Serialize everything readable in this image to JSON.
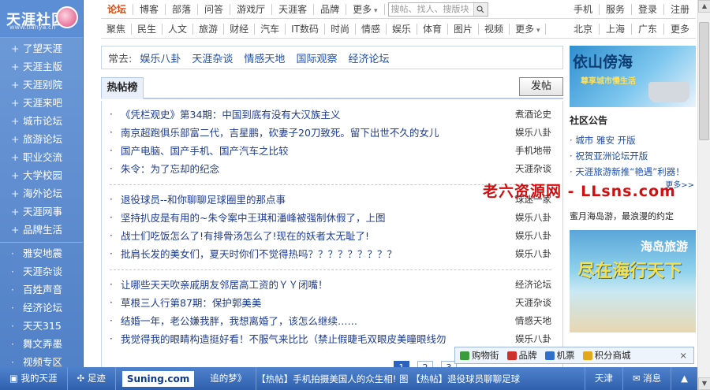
{
  "logo": {
    "name": "天涯社区",
    "url": "www.tianya.cn"
  },
  "sidebar": {
    "primary": [
      "了望天涯",
      "天涯主版",
      "天涯别院",
      "天涯来吧",
      "城市论坛",
      "旅游论坛",
      "职业交流",
      "大学校园",
      "海外论坛",
      "天涯网事",
      "品牌生活"
    ],
    "secondary": [
      "雅安地震",
      "天涯杂谈",
      "百姓声音",
      "经济论坛",
      "天天315",
      "舞文弄墨",
      "视频专区"
    ]
  },
  "topbar": {
    "tabs": [
      "论坛",
      "博客",
      "部落",
      "问答",
      "游戏厅",
      "天涯客",
      "品牌",
      "更多"
    ],
    "search_placeholder": "搜帖、找人、搜版块",
    "right": [
      "手机",
      "服务",
      "登录",
      "注册"
    ]
  },
  "subbar": {
    "tabs": [
      "聚焦",
      "民生",
      "人文",
      "旅游",
      "财经",
      "汽车",
      "IT数码",
      "时尚",
      "情感",
      "娱乐",
      "体育",
      "图片",
      "视频",
      "更多"
    ],
    "right": [
      "北京",
      "上海",
      "广东",
      "更多"
    ]
  },
  "frequent": {
    "label": "常去:",
    "links": [
      "娱乐八卦",
      "天涯杂谈",
      "情感天地",
      "国际观察",
      "经济论坛"
    ]
  },
  "hot": {
    "tab": "热帖榜",
    "post_button": "发帖",
    "groups": [
      [
        {
          "title": "《凭栏观史》第34期：中国到底有没有大汉族主义",
          "cat": "煮酒论史"
        },
        {
          "title": "南京超跑俱乐部富二代，吉星鹏，砍妻子20刀致死。留下出世不久的女儿",
          "cat": "娱乐八卦"
        },
        {
          "title": "国产电脑、国产手机、国产汽车之比较",
          "cat": "手机地带"
        },
        {
          "title": "朱令：为了忘却的纪念",
          "cat": "天涯杂谈"
        }
      ],
      [
        {
          "title": "退役球员--和你聊聊足球圈里的那点事",
          "cat": "球迷一家"
        },
        {
          "title": "坚持扒皮是有用的~朱令案中王琪和潘峰被强制休假了，上图",
          "cat": "娱乐八卦"
        },
        {
          "title": "战士们吃饭怎么了!有排骨汤怎么了!现在的妖者太无耻了!",
          "cat": "娱乐八卦"
        },
        {
          "title": "批肩长发的美女们，夏天时你们不觉得热吗？？？？？？？？？",
          "cat": "娱乐八卦"
        }
      ],
      [
        {
          "title": "让哪些天天吹亲戚朋友邻居高工资的ＹＹ闭嘴！",
          "cat": "经济论坛"
        },
        {
          "title": "草根三人行第87期：保护郭美美",
          "cat": "天涯杂谈"
        },
        {
          "title": "结婚一年，老公嫌我胖，我想离婚了，该怎么继续……",
          "cat": "情感天地"
        },
        {
          "title": "我觉得我的眼睛构造挺好看！不服气来比比（禁止假睫毛双眼皮美瞳眼线勿",
          "cat": "娱乐八卦"
        }
      ]
    ],
    "pages": [
      "1",
      "2",
      "3"
    ]
  },
  "right": {
    "ad1_title": "依山傍海",
    "ad1_sub": "尊享城市慢生活",
    "notice_title": "社区公告",
    "notices": [
      "城市 雅安 开版",
      "祝贺亚洲论坛开版",
      "天涯旅游新推“艳遇”利器！"
    ],
    "more": "更多>>",
    "ad_text": "蜜月海岛游，最浪漫的约定",
    "ad2_title": "海岛旅游",
    "ad2_sub": "尽在海行天下"
  },
  "watermark": "老六资源网 - LLsns.com",
  "shopbar": {
    "items": [
      "购物街",
      "品牌",
      "机票",
      "积分商城"
    ],
    "close": "×"
  },
  "bottombar": {
    "my": "我的天涯",
    "footprint": "足迹",
    "suning": "Suning.com",
    "dream": "追的梦》",
    "news": "【热帖】手机拍摄美国人的众生相! 图  【热帖】退役球员聊聊足球",
    "city": "天津",
    "msg": "消息"
  },
  "colors": {
    "sidebar": "#5c8ed6",
    "active": "#d9480f",
    "link": "#1f3c8f",
    "bottom": "#2f60ad"
  }
}
